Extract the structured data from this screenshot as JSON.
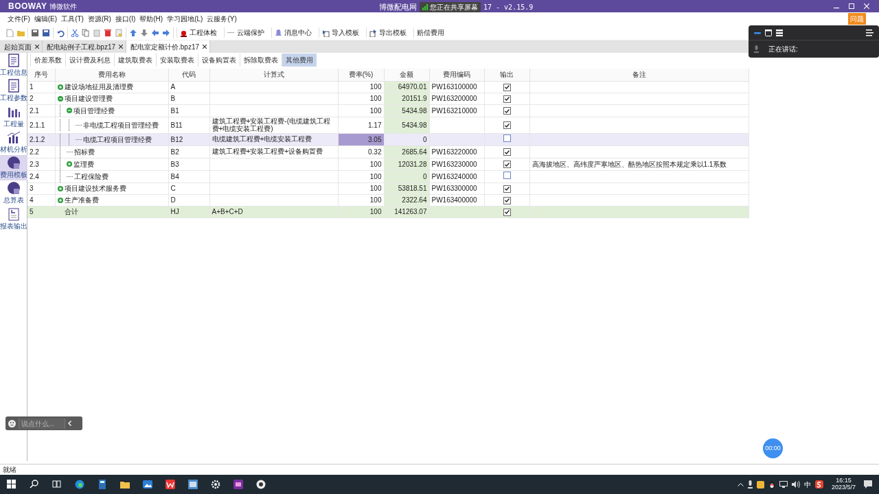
{
  "window": {
    "logo": "BOOWAY",
    "logo_cn": "博微软件",
    "title": "博微配电网",
    "share_banner": "您正在共享屏幕",
    "title_tail": "17 - v2.15.9",
    "help_button": "问题"
  },
  "menu": [
    "文件(F)",
    "编辑(E)",
    "工具(T)",
    "资源(R)",
    "接口(I)",
    "帮助(H)",
    "学习园地(L)",
    "云服务(Y)"
  ],
  "toolbar_buttons": [
    {
      "label": "工程体检",
      "kind": "check"
    },
    {
      "label": "云端保护",
      "kind": "cloud"
    },
    {
      "label": "消息中心",
      "kind": "bell"
    },
    {
      "label": "导入模板",
      "kind": "import"
    },
    {
      "label": "导出模板",
      "kind": "export"
    },
    {
      "label": "赔偿费用",
      "kind": "plain"
    }
  ],
  "doc_tabs": [
    {
      "label": "起始页面",
      "selected": false
    },
    {
      "label": "配电站例子工程.bpz17",
      "selected": false
    },
    {
      "label": "配电室定额计价.bpz17",
      "selected": true
    }
  ],
  "sub_tabs": [
    {
      "label": "价差系数",
      "selected": false
    },
    {
      "label": "设计费及利息",
      "selected": false
    },
    {
      "label": "建筑取费表",
      "selected": false
    },
    {
      "label": "安装取费表",
      "selected": false
    },
    {
      "label": "设备购置表",
      "selected": false
    },
    {
      "label": "拆除取费表",
      "selected": false
    },
    {
      "label": "其他费用",
      "selected": true
    }
  ],
  "sidebar": [
    {
      "label": "工程信息",
      "kind": "doc",
      "selected": false
    },
    {
      "label": "工程参数",
      "kind": "doc",
      "selected": false
    },
    {
      "label": "工程量",
      "kind": "bars",
      "selected": false
    },
    {
      "label": "材机分析",
      "kind": "chart",
      "selected": false
    },
    {
      "label": "费用模板",
      "kind": "disc",
      "selected": true
    },
    {
      "label": "总算表",
      "kind": "disc",
      "selected": false
    },
    {
      "label": "报表输出",
      "kind": "report",
      "selected": false
    }
  ],
  "table": {
    "columns": [
      "序号",
      "费用名称",
      "代码",
      "计算式",
      "费率(%)",
      "金额",
      "费用编码",
      "输出",
      "备注"
    ],
    "rows": [
      {
        "no": "1",
        "name": "建设场地征用及清理费",
        "code": "A",
        "rate": "100",
        "amount": "64970.01",
        "fee_code": "PW163100000",
        "output": true,
        "kind": "item",
        "expanded": false,
        "selected": false
      },
      {
        "no": "2",
        "name": "项目建设管理费",
        "code": "B",
        "rate": "100",
        "amount": "20151.9",
        "fee_code": "PW163200000",
        "output": true,
        "kind": "item",
        "expanded": true,
        "selected": false,
        "children": [
          {
            "no": "2.1",
            "name": "项目管理经费",
            "code": "B1",
            "rate": "100",
            "amount": "5434.98",
            "fee_code": "PW163210000",
            "output": true,
            "kind": "item",
            "expanded": true,
            "selected": false,
            "children": [
              {
                "no": "2.1.1",
                "name": "非电缆工程项目管理经费",
                "code": "B11",
                "formula": "建筑工程费+安装工程费-(电缆建筑工程费+电缆安装工程费)",
                "rate": "1.17",
                "amount": "5434.98",
                "output": true,
                "kind": "item",
                "selected": false
              },
              {
                "no": "2.1.2",
                "name": "电缆工程项目管理经费",
                "code": "B12",
                "formula": "电缆建筑工程费+电缆安装工程费",
                "rate": "3.05",
                "amount": "0",
                "output": false,
                "kind": "item",
                "selected": true
              }
            ]
          },
          {
            "no": "2.2",
            "name": "招标费",
            "code": "B2",
            "formula": "建筑工程费+安装工程费+设备购置费",
            "rate": "0.32",
            "amount": "2685.64",
            "fee_code": "PW163220000",
            "output": true,
            "kind": "item",
            "selected": false
          },
          {
            "no": "2.3",
            "name": "监理费",
            "code": "B3",
            "rate": "100",
            "amount": "12031.28",
            "fee_code": "PW163230000",
            "output": true,
            "note": "高海拔地区、高纬度严寒地区、酷热地区按照本规定乘以1.1系数",
            "kind": "item",
            "expanded": false,
            "selected": false
          },
          {
            "no": "2.4",
            "name": "工程保险费",
            "code": "B4",
            "rate": "100",
            "amount": "0",
            "fee_code": "PW163240000",
            "output": false,
            "kind": "item",
            "selected": false
          }
        ]
      },
      {
        "no": "3",
        "name": "项目建设技术服务费",
        "code": "C",
        "rate": "100",
        "amount": "53818.51",
        "fee_code": "PW163300000",
        "output": true,
        "kind": "item",
        "expanded": false,
        "selected": false
      },
      {
        "no": "4",
        "name": "生产准备费",
        "code": "D",
        "rate": "100",
        "amount": "2322.64",
        "fee_code": "PW163400000",
        "output": true,
        "kind": "item",
        "expanded": false,
        "selected": false
      },
      {
        "no": "5",
        "name": "合计",
        "code": "HJ",
        "formula": "A+B+C+D",
        "rate": "100",
        "amount": "141263.07",
        "output": true,
        "kind": "total",
        "selected": false
      }
    ]
  },
  "meeting_panel": {
    "speaking": "正在讲话:"
  },
  "chat_bar": {
    "placeholder": "说点什么..."
  },
  "timer": "00:00",
  "status_bar": "就绪",
  "taskbar": {
    "ime": "中",
    "time": "16:15",
    "date": "2023/5/7"
  }
}
